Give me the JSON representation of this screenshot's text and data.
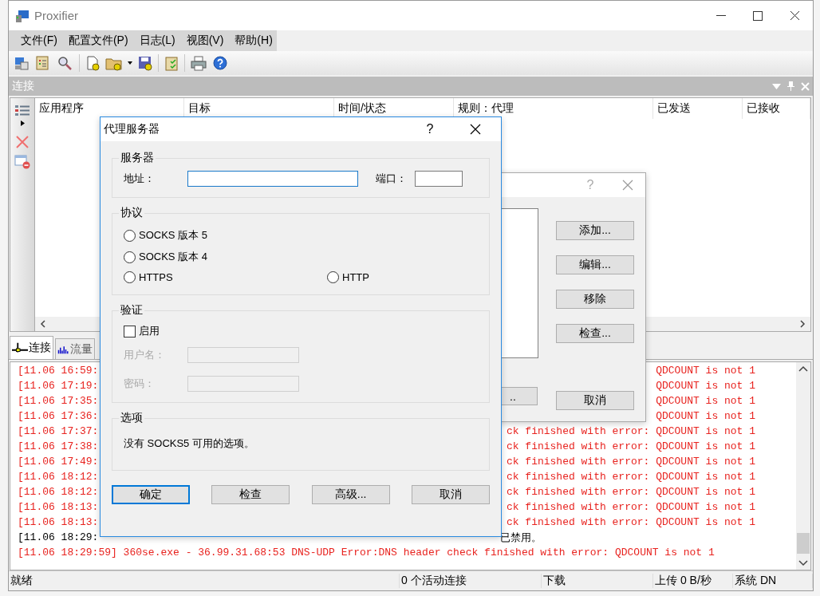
{
  "window": {
    "title": "Proxifier"
  },
  "menu": [
    "文件(F)",
    "配置文件(P)",
    "日志(L)",
    "视图(V)",
    "帮助(H)"
  ],
  "panel": {
    "title": "连接"
  },
  "table": {
    "columns": [
      "应用程序",
      "目标",
      "时间/状态",
      "规则：代理",
      "已发送",
      "已接收"
    ]
  },
  "bottom_tabs": [
    {
      "label": "连接",
      "selected": true
    },
    {
      "label": "流量",
      "selected": false
    }
  ],
  "log": [
    {
      "kind": "error",
      "time": "[11.06 16:59:",
      "tail": "QDCOUNT is not 1"
    },
    {
      "kind": "error",
      "time": "[11.06 17:19:",
      "tail": "QDCOUNT is not 1"
    },
    {
      "kind": "error",
      "time": "[11.06 17:35:",
      "tail": "QDCOUNT is not 1"
    },
    {
      "kind": "error",
      "time": "[11.06 17:36:",
      "tail": "QDCOUNT is not 1"
    },
    {
      "kind": "error",
      "time": "[11.06 17:37:",
      "tail": "ck finished with error: QDCOUNT is not 1"
    },
    {
      "kind": "error",
      "time": "[11.06 17:38:",
      "tail": "ck finished with error: QDCOUNT is not 1"
    },
    {
      "kind": "error",
      "time": "[11.06 17:49:",
      "tail": "ck finished with error: QDCOUNT is not 1"
    },
    {
      "kind": "error",
      "time": "[11.06 18:12:",
      "tail": "ck finished with error: QDCOUNT is not 1"
    },
    {
      "kind": "error",
      "time": "[11.06 18:12:",
      "tail": "ck finished with error: QDCOUNT is not 1"
    },
    {
      "kind": "error",
      "time": "[11.06 18:13:",
      "tail": "ck finished with error: QDCOUNT is not 1"
    },
    {
      "kind": "error",
      "time": "[11.06 18:13:",
      "tail": "ck finished with error: QDCOUNT is not 1"
    },
    {
      "kind": "info",
      "time": "[11.06 18:29:",
      "tail": "已禁用。"
    },
    {
      "kind": "error",
      "time": "[11.06 18:29:59] 360se.exe - 36.99.31.68:53 DNS-UDP Error:DNS header check finished with error: QDCOUNT is not 1"
    }
  ],
  "status_bar": [
    "就绪",
    "0 个活动连接",
    "下载",
    "上传 0 B/秒",
    "系统 DN"
  ],
  "back_dialog": {
    "help": "?",
    "buttons": [
      "添加...",
      "编辑...",
      "移除",
      "检查..."
    ],
    "partial_button": "..",
    "cancel": "取消"
  },
  "dialog": {
    "title": "代理服务器",
    "help": "?",
    "server": {
      "title": "服务器",
      "address_label": "地址：",
      "port_label": "端口："
    },
    "protocol": {
      "title": "协议",
      "options": [
        {
          "label": "SOCKS 版本 5",
          "selected": false
        },
        {
          "label": "SOCKS 版本 4",
          "selected": false
        },
        {
          "label": "HTTPS",
          "selected": false
        },
        {
          "label": "HTTP",
          "selected": false
        }
      ]
    },
    "auth": {
      "title": "验证",
      "enable": {
        "label": "启用",
        "checked": false
      },
      "disabled": true,
      "username_label": "用户名：",
      "password_label": "密码："
    },
    "options": {
      "title": "选项",
      "text": "没有 SOCKS5 可用的选项。"
    },
    "buttons": [
      "确定",
      "检查",
      "高级...",
      "取消"
    ]
  }
}
